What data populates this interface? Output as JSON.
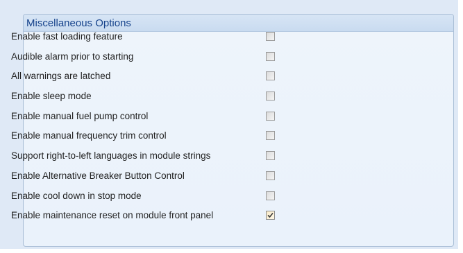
{
  "group": {
    "title": "Miscellaneous Options"
  },
  "options": [
    {
      "label": "Enable fast loading feature",
      "checked": false
    },
    {
      "label": "Audible alarm prior to starting",
      "checked": false
    },
    {
      "label": "All warnings are latched",
      "checked": false
    },
    {
      "label": "Enable sleep mode",
      "checked": false
    },
    {
      "label": "Enable manual fuel pump control",
      "checked": false
    },
    {
      "label": "Enable manual frequency trim control",
      "checked": false
    },
    {
      "label": "Support right-to-left languages in module strings",
      "checked": false
    },
    {
      "label": "Enable Alternative Breaker Button Control",
      "checked": false
    },
    {
      "label": "Enable cool down in stop mode",
      "checked": false
    },
    {
      "label": "Enable maintenance reset on module front panel",
      "checked": true
    }
  ],
  "colors": {
    "background": "#dfe9f6",
    "header_text": "#15428b",
    "checkmark": "#3a3a3a"
  },
  "icons": {
    "checkbox_checked": "checkmark-icon"
  }
}
